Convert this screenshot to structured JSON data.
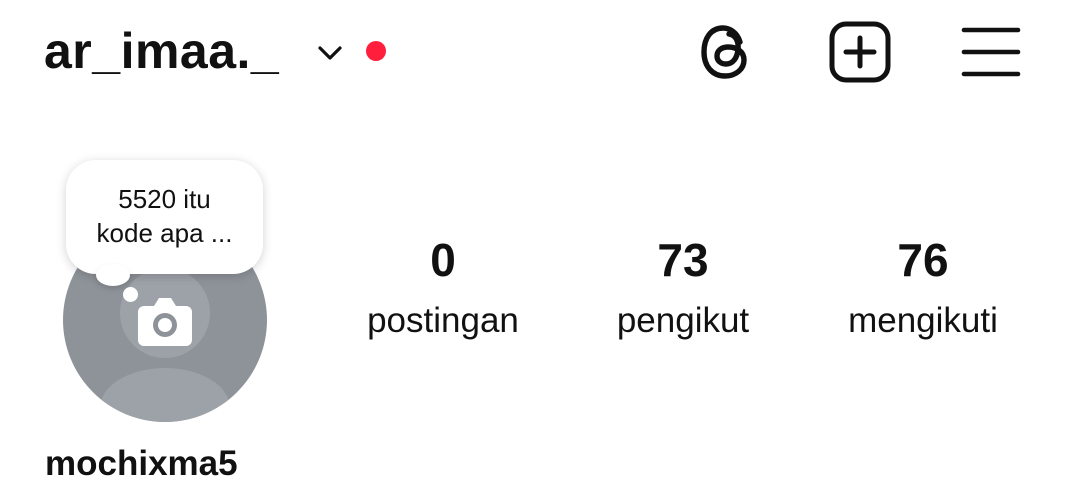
{
  "header": {
    "username": "ar_imaa._",
    "icons": {
      "switch_account": "chevron-down-icon",
      "notification": "red-dot",
      "threads": "threads-icon",
      "create": "plus-square-icon",
      "menu": "hamburger-menu-icon"
    },
    "accent_color": "#ff1f3d"
  },
  "profile": {
    "note_lines": [
      "5520 itu",
      "kode apa ..."
    ],
    "avatar_icon": "camera-icon",
    "display_name": "mochixma5"
  },
  "stats": [
    {
      "value": "0",
      "label": "postingan"
    },
    {
      "value": "73",
      "label": "pengikut"
    },
    {
      "value": "76",
      "label": "mengikuti"
    }
  ]
}
